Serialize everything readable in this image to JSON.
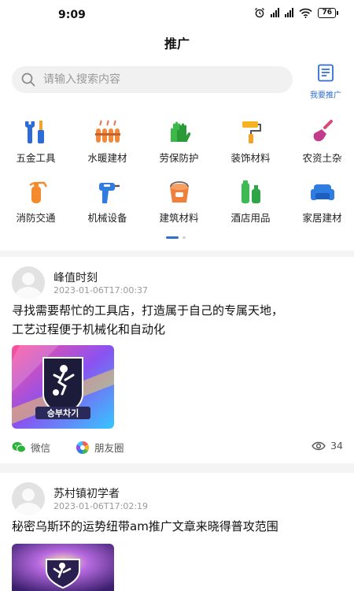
{
  "status": {
    "time": "9:09",
    "battery": "76"
  },
  "header": {
    "title": "推广"
  },
  "search": {
    "placeholder": "请输入搜索内容"
  },
  "promote": {
    "label": "我要推广"
  },
  "categories": [
    {
      "label": "五金工具",
      "icon": "wrench-screwdriver-icon"
    },
    {
      "label": "水暖建材",
      "icon": "radiator-icon"
    },
    {
      "label": "劳保防护",
      "icon": "gloves-icon"
    },
    {
      "label": "装饰材料",
      "icon": "paint-roller-icon"
    },
    {
      "label": "农资土杂",
      "icon": "shovel-icon"
    },
    {
      "label": "消防交通",
      "icon": "fire-extinguisher-icon"
    },
    {
      "label": "机械设备",
      "icon": "drill-icon"
    },
    {
      "label": "建筑材料",
      "icon": "paint-bucket-icon"
    },
    {
      "label": "酒店用品",
      "icon": "toiletries-icon"
    },
    {
      "label": "家居建材",
      "icon": "sofa-icon"
    }
  ],
  "posts": [
    {
      "user": "峰值时刻",
      "date": "2023-01-06T17:00:37",
      "text_line1": "寻找需要帮忙的工具店，打造属于自己的专属天地，",
      "text_line2": "工艺过程便于机械化和自动化",
      "image_caption": "승부차기",
      "share_wechat": "微信",
      "share_moments": "朋友圈",
      "views": "34"
    },
    {
      "user": "苏村镇初学者",
      "date": "2023-01-06T17:02:19",
      "text_line1": "秘密乌斯环的运势纽带am推广文章来晓得普攻范围"
    }
  ],
  "colors": {
    "accent": "#2f6fd3",
    "wechat": "#2bb33a",
    "page_bg": "#f4f4f4"
  }
}
